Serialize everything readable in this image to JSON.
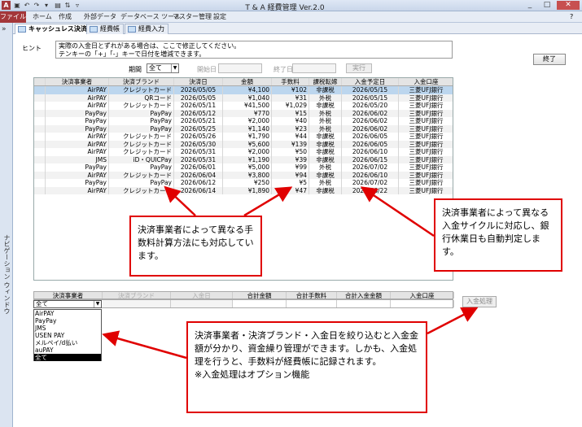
{
  "titlebar": {
    "app_icon_letter": "A",
    "title": "T & A 経費管理 Ver.2.0",
    "min": "_",
    "max": "□",
    "close": "✕"
  },
  "ribbon": {
    "file_tab": "ファイル",
    "tabs": [
      "ホーム",
      "作成",
      "外部データ",
      "データベース ツール",
      "マスター管理",
      "設定"
    ]
  },
  "nav": {
    "toggle": "»",
    "label": "ナビゲーション ウィンドウ"
  },
  "doc_tabs": [
    "キャッシュレス決済管理",
    "経費帳",
    "経費入力"
  ],
  "hint": {
    "label": "ヒント",
    "text": "実際の入金日とずれがある場合は、ここで修正してください。\nテンキーの「+」「-」キーで日付を増減できます。"
  },
  "close_button": "終了",
  "filter": {
    "period_label": "期間",
    "period_value": "全て",
    "start_label": "開始日",
    "end_label": "終了日",
    "run_button": "実行"
  },
  "grid": {
    "headers": [
      "決済事業者",
      "決済ブランド",
      "決済日",
      "金額",
      "手数料",
      "課税転嫁",
      "入金予定日",
      "入金口座"
    ],
    "rows": [
      [
        "AirPAY",
        "クレジットカード",
        "2026/05/05",
        "¥4,100",
        "¥102",
        "非課税",
        "2026/05/15",
        "三菱UFJ銀行"
      ],
      [
        "AirPAY",
        "QRコード",
        "2026/05/05",
        "¥1,040",
        "¥31",
        "外税",
        "2026/05/15",
        "三菱UFJ銀行"
      ],
      [
        "AirPAY",
        "クレジットカード",
        "2026/05/11",
        "¥41,500",
        "¥1,029",
        "非課税",
        "2026/05/20",
        "三菱UFJ銀行"
      ],
      [
        "PayPay",
        "PayPay",
        "2026/05/12",
        "¥770",
        "¥15",
        "外税",
        "2026/06/02",
        "三菱UFJ銀行"
      ],
      [
        "PayPay",
        "PayPay",
        "2026/05/21",
        "¥2,000",
        "¥40",
        "外税",
        "2026/06/02",
        "三菱UFJ銀行"
      ],
      [
        "PayPay",
        "PayPay",
        "2026/05/25",
        "¥1,140",
        "¥23",
        "外税",
        "2026/06/02",
        "三菱UFJ銀行"
      ],
      [
        "AirPAY",
        "クレジットカード",
        "2026/05/26",
        "¥1,790",
        "¥44",
        "非課税",
        "2026/06/05",
        "三菱UFJ銀行"
      ],
      [
        "AirPAY",
        "クレジットカード",
        "2026/05/30",
        "¥5,600",
        "¥139",
        "非課税",
        "2026/06/05",
        "三菱UFJ銀行"
      ],
      [
        "AirPAY",
        "クレジットカード",
        "2026/05/31",
        "¥2,000",
        "¥50",
        "非課税",
        "2026/06/10",
        "三菱UFJ銀行"
      ],
      [
        "JMS",
        "iD・QUICPay",
        "2026/05/31",
        "¥1,190",
        "¥39",
        "非課税",
        "2026/06/15",
        "三菱UFJ銀行"
      ],
      [
        "PayPay",
        "PayPay",
        "2026/06/01",
        "¥5,000",
        "¥99",
        "外税",
        "2026/07/02",
        "三菱UFJ銀行"
      ],
      [
        "AirPAY",
        "クレジットカード",
        "2026/06/04",
        "¥3,800",
        "¥94",
        "非課税",
        "2026/06/10",
        "三菱UFJ銀行"
      ],
      [
        "PayPay",
        "PayPay",
        "2026/06/12",
        "¥250",
        "¥5",
        "外税",
        "2026/07/02",
        "三菱UFJ銀行"
      ],
      [
        "AirPAY",
        "クレジットカード",
        "2026/06/14",
        "¥1,890",
        "¥47",
        "非課税",
        "2026/06/22",
        "三菱UFJ銀行"
      ]
    ]
  },
  "summary": {
    "headers": [
      "決済事業者",
      "決済ブランド",
      "入金日",
      "合計金額",
      "合計手数料",
      "合計入金金額",
      "入金口座"
    ],
    "provider_value": "全て",
    "dropdown_options": [
      "AirPAY",
      "PayPay",
      "JMS",
      "USEN PAY",
      "メルペイ/d払い",
      "auPAY",
      "全て"
    ],
    "deposit_button": "入金処理"
  },
  "callouts": {
    "c1": "決済事業者によって異なる手数料計算方法にも対応しています。",
    "c2": "決済事業者によって異なる入金サイクルに対応し、銀行休業日も自動判定します。",
    "c3": "決済事業者・決済ブランド・入金日を絞り込むと入金金額が分かり、資金繰り管理ができます。しかも、入金処理を行うと、手数料が経費帳に記録されます。\n※入金処理はオプション機能"
  },
  "colors": {
    "accent_red": "#e00000",
    "access_brand": "#a4373a",
    "selected_row": "#bcd6ee"
  }
}
